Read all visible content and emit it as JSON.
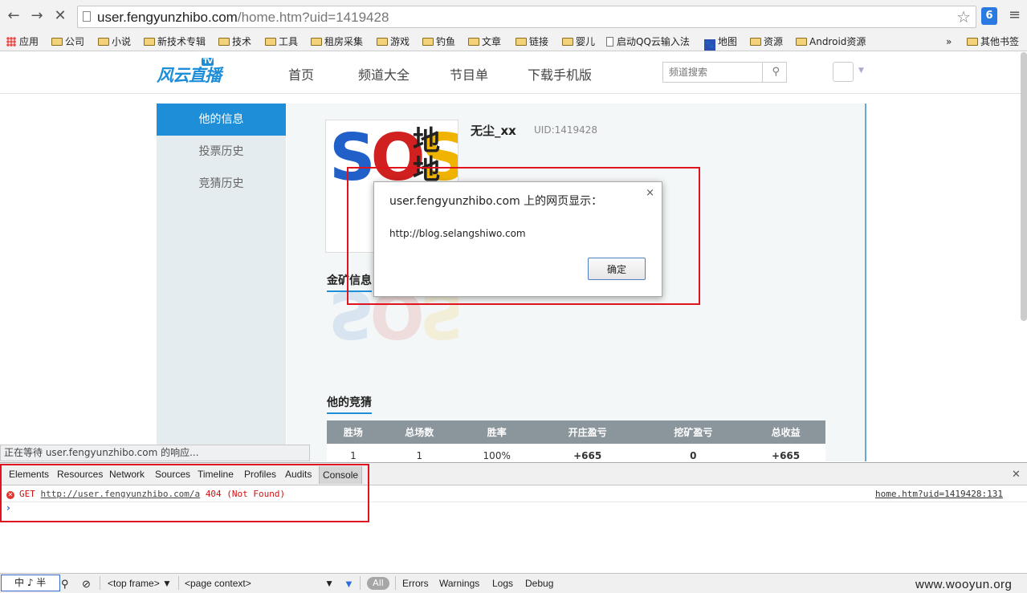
{
  "browser": {
    "url_host": "user.fengyunzhibo.com",
    "url_path": "/home.htm?uid=1419428",
    "ext_label": "6"
  },
  "bookmarks": [
    {
      "label": "应用",
      "icon": "apps-icon"
    },
    {
      "label": "公司",
      "icon": "folder-icon"
    },
    {
      "label": "小说",
      "icon": "folder-icon"
    },
    {
      "label": "新技术专辑",
      "icon": "folder-icon"
    },
    {
      "label": "技术",
      "icon": "folder-icon"
    },
    {
      "label": "工具",
      "icon": "folder-icon"
    },
    {
      "label": "租房采集",
      "icon": "folder-icon"
    },
    {
      "label": "游戏",
      "icon": "folder-icon"
    },
    {
      "label": "钓鱼",
      "icon": "folder-icon"
    },
    {
      "label": "文章",
      "icon": "folder-icon"
    },
    {
      "label": "链接",
      "icon": "folder-icon"
    },
    {
      "label": "婴儿",
      "icon": "folder-icon"
    },
    {
      "label": "启动QQ云输入法",
      "icon": "page-icon"
    },
    {
      "label": "地图",
      "icon": "paw-icon"
    },
    {
      "label": "资源",
      "icon": "folder-icon"
    },
    {
      "label": "Android资源",
      "icon": "folder-icon"
    }
  ],
  "bookmarks_more": "»",
  "bookmarks_other": "其他书签",
  "site": {
    "logo_text": "风云直播",
    "logo_badge": "TV",
    "nav": [
      "首页",
      "频道大全",
      "节目单",
      "下载手机版"
    ],
    "search_placeholder": "频道搜索"
  },
  "sidebar": [
    "他的信息",
    "投票历史",
    "竞猜历史"
  ],
  "profile": {
    "avatar_text": "SOSO",
    "avatar_overlay": "地地",
    "name": "无尘_xx",
    "uid": "UID:1419428",
    "section_gold": "金矿信息",
    "section_bets": "他的竞猜"
  },
  "stats": {
    "headers": [
      "胜场",
      "总场数",
      "胜率",
      "开庄盈亏",
      "挖矿盈亏",
      "总收益"
    ],
    "row": [
      "1",
      "1",
      "100%",
      "+665",
      "0",
      "+665"
    ]
  },
  "dialog": {
    "title": "user.fengyunzhibo.com 上的网页显示：",
    "close": "×",
    "message": "http://blog.selangshiwo.com",
    "ok": "确定"
  },
  "status_text": "正在等待 user.fengyunzhibo.com 的响应...",
  "devtools": {
    "tabs": [
      "Elements",
      "Resources",
      "Network",
      "Sources",
      "Timeline",
      "Profiles",
      "Audits",
      "Console"
    ],
    "error": {
      "method": "GET",
      "url": "http://user.fengyunzhibo.com/a",
      "status": "404 (Not Found)",
      "source": "home.htm?uid=1419428:131"
    },
    "prompt": "›",
    "frame": "<top frame>",
    "context": "<page context>",
    "filters": [
      "All",
      "Errors",
      "Warnings",
      "Logs",
      "Debug"
    ],
    "ime": "中 ♪ 半"
  },
  "watermark": "www.wooyun.org",
  "colors": {
    "accent": "#1e8ed8",
    "highlight_box": "#e0141e"
  }
}
